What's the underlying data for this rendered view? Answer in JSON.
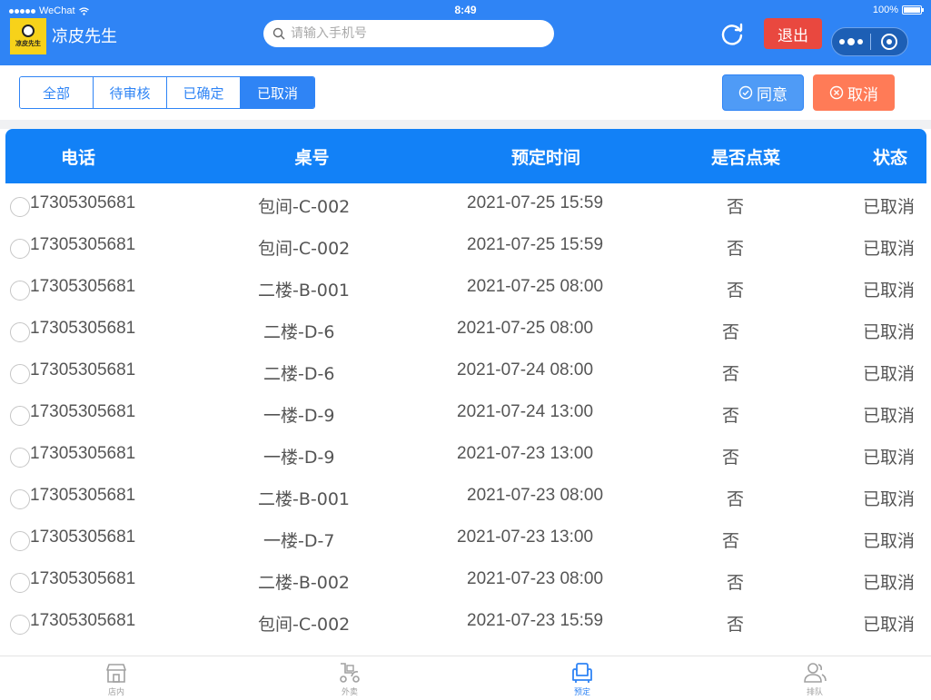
{
  "status_bar": {
    "carrier": "WeChat",
    "time": "8:49",
    "battery": "100%"
  },
  "header": {
    "logo_text": "凉皮先生",
    "shop_name": "凉皮先生",
    "search_placeholder": "请输入手机号",
    "logout_label": "退出"
  },
  "tabs": [
    {
      "label": "全部",
      "active": false
    },
    {
      "label": "待审核",
      "active": false
    },
    {
      "label": "已确定",
      "active": false
    },
    {
      "label": "已取消",
      "active": true
    }
  ],
  "actions": {
    "agree_label": "同意",
    "cancel_label": "取消"
  },
  "table": {
    "columns": [
      "电话",
      "桌号",
      "预定时间",
      "是否点菜",
      "状态"
    ],
    "rows": [
      {
        "phone": "17305305681",
        "table": "包间-C-002",
        "time": "2021-07-25 15:59",
        "ordered": "否",
        "status": "已取消"
      },
      {
        "phone": "17305305681",
        "table": "包间-C-002",
        "time": "2021-07-25 15:59",
        "ordered": "否",
        "status": "已取消"
      },
      {
        "phone": "17305305681",
        "table": "二楼-B-001",
        "time": "2021-07-25 08:00",
        "ordered": "否",
        "status": "已取消"
      },
      {
        "phone": "17305305681",
        "table": "二楼-D-6",
        "time": "2021-07-25 08:00",
        "ordered": "否",
        "status": "已取消"
      },
      {
        "phone": "17305305681",
        "table": "二楼-D-6",
        "time": "2021-07-24 08:00",
        "ordered": "否",
        "status": "已取消"
      },
      {
        "phone": "17305305681",
        "table": "一楼-D-9",
        "time": "2021-07-24 13:00",
        "ordered": "否",
        "status": "已取消"
      },
      {
        "phone": "17305305681",
        "table": "一楼-D-9",
        "time": "2021-07-23 13:00",
        "ordered": "否",
        "status": "已取消"
      },
      {
        "phone": "17305305681",
        "table": "二楼-B-001",
        "time": "2021-07-23 08:00",
        "ordered": "否",
        "status": "已取消"
      },
      {
        "phone": "17305305681",
        "table": "一楼-D-7",
        "time": "2021-07-23 13:00",
        "ordered": "否",
        "status": "已取消"
      },
      {
        "phone": "17305305681",
        "table": "二楼-B-002",
        "time": "2021-07-23 08:00",
        "ordered": "否",
        "status": "已取消"
      },
      {
        "phone": "17305305681",
        "table": "包间-C-002",
        "time": "2021-07-23 15:59",
        "ordered": "否",
        "status": "已取消"
      }
    ]
  },
  "tabbar": [
    {
      "label": "店内",
      "icon": "store-icon",
      "active": false
    },
    {
      "label": "外卖",
      "icon": "scooter-icon",
      "active": false
    },
    {
      "label": "预定",
      "icon": "armchair-icon",
      "active": true
    },
    {
      "label": "排队",
      "icon": "people-icon",
      "active": false
    }
  ],
  "colors": {
    "primary": "#2f84f5",
    "table_header": "#1281f7",
    "logout": "#e9483f",
    "cancel": "#ff7b57",
    "agree": "#4f9bf6"
  }
}
